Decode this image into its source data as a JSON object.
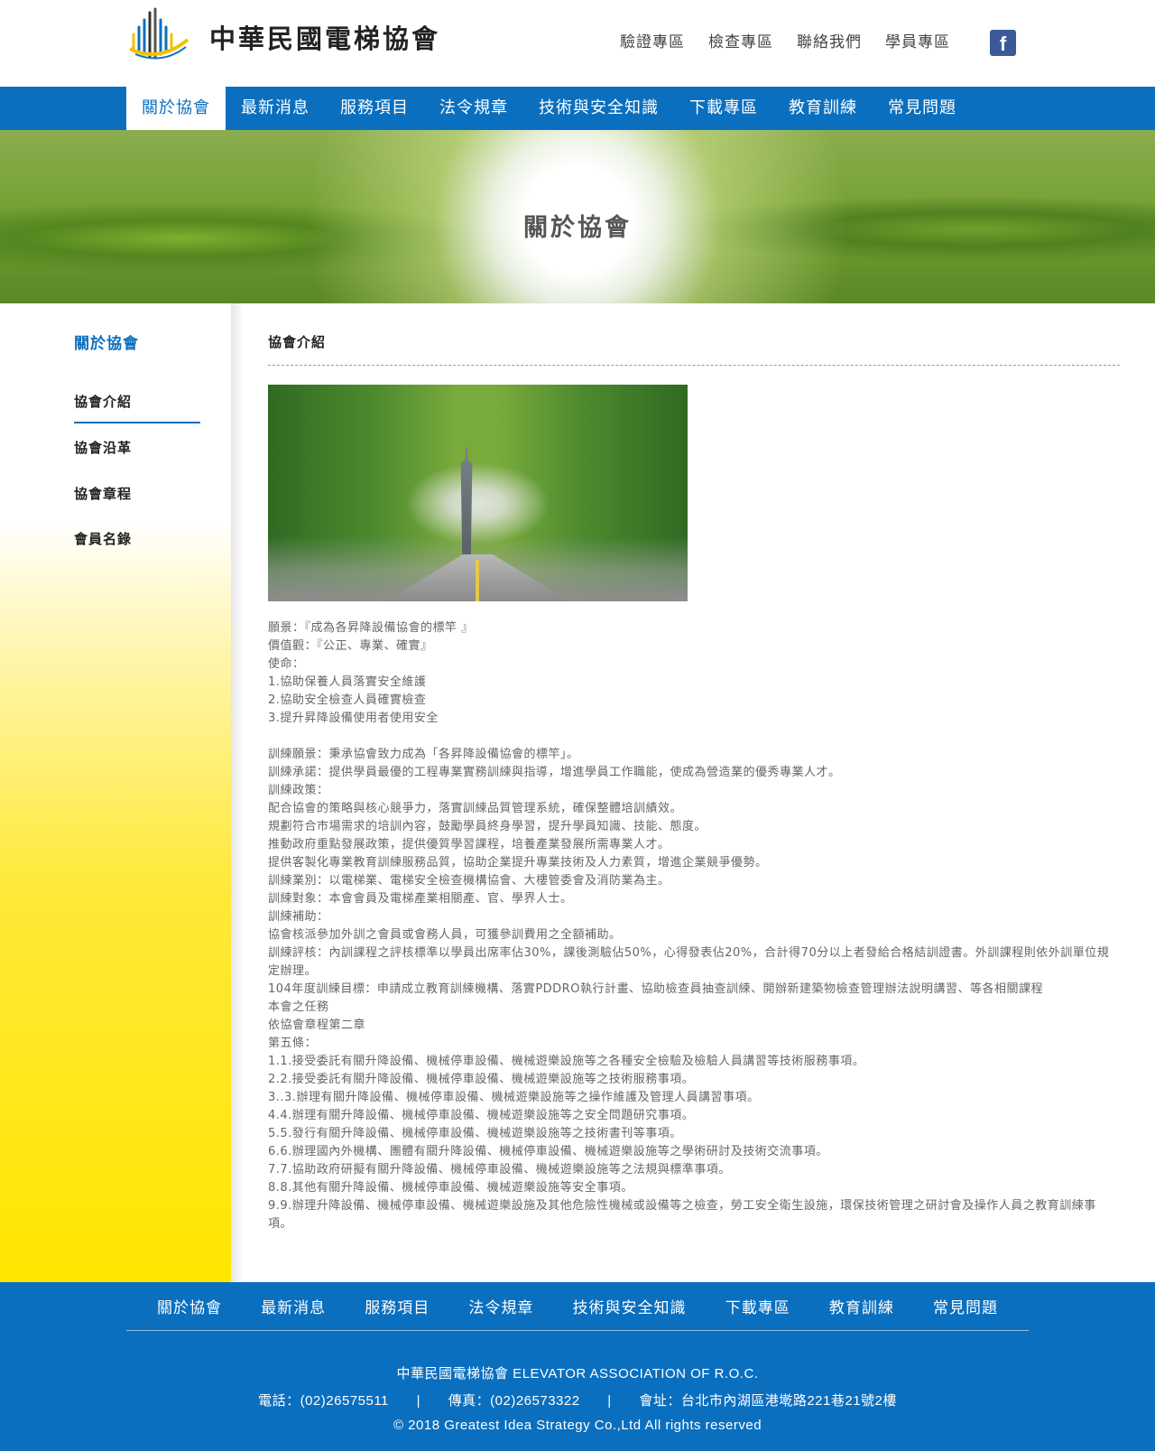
{
  "header": {
    "logo_text": "中華民國電梯協會",
    "top_links": [
      "驗證專區",
      "檢查專區",
      "聯絡我們",
      "學員專區"
    ],
    "facebook_glyph": "f",
    "icons": {
      "facebook": "facebook-icon",
      "logo": "elevator-association-logo"
    }
  },
  "nav": {
    "items": [
      "關於協會",
      "最新消息",
      "服務項目",
      "法令規章",
      "技術與安全知識",
      "下載專區",
      "教育訓練",
      "常見問題"
    ],
    "active": "關於協會"
  },
  "banner": {
    "title": "關於協會"
  },
  "sidebar": {
    "title": "關於協會",
    "items": [
      "協會介紹",
      "協會沿革",
      "協會章程",
      "會員名錄"
    ],
    "active": "協會介紹"
  },
  "content": {
    "title": "協會介紹",
    "lines": [
      "願景：『成為各昇降設備協會的標竿 』",
      "價值觀：『公正、專業、確實』",
      "使命：",
      "1.協助保養人員落實安全維護",
      "2.協助安全檢查人員確實檢查",
      "3.提升昇降設備使用者使用安全",
      "",
      "訓練願景：秉承協會致力成為「各昇降設備協會的標竿」。",
      "訓練承諾：提供學員最優的工程專業實務訓練與指導，增進學員工作職能，使成為營造業的優秀專業人才。",
      "訓練政策：",
      "配合協會的策略與核心競爭力，落實訓練品質管理系統，確保整體培訓績效。",
      "規劃符合市場需求的培訓內容，鼓勵學員終身學習，提升學員知識、技能、態度。",
      "推動政府重點發展政策，提供優質學習課程，培養產業發展所需專業人才。",
      "提供客製化專業教育訓練服務品質，協助企業提升專業技術及人力素質，增進企業競爭優勢。",
      "訓練業別：以電梯業、電梯安全檢查機構協會、大樓管委會及消防業為主。",
      "訓練對象：本會會員及電梯產業相關產、官、學界人士。",
      "訓練補助：",
      "協會核派參加外訓之會員或會務人員，可獲參訓費用之全額補助。",
      "訓練評核：內訓課程之評核標準以學員出席率佔30%，課後測驗佔50%，心得發表佔20%，合計得70分以上者發給合格結訓證書。外訓課程則依外訓單位規定辦理。",
      "104年度訓練目標：申請成立教育訓練機構、落實PDDRO執行計畫、協助檢查員抽查訓練、開辦新建築物檢查管理辦法說明講習、等各相關課程",
      "本會之任務",
      "依協會章程第二章",
      "第五條：",
      "1.1.接受委託有關升降設備、機械停車設備、機械遊樂設施等之各種安全檢驗及檢驗人員講習等技術服務事項。",
      "2.2.接受委託有關升降設備、機械停車設備、機械遊樂設施等之技術服務事項。",
      "3..3.辦理有關升降設備、機械停車設備、機械遊樂設施等之操作維護及管理人員講習事項。",
      "4.4.辦理有關升降設備、機械停車設備、機械遊樂設施等之安全問題研究事項。",
      "5.5.發行有關升降設備、機械停車設備、機械遊樂設施等之技術書刊等事項。",
      "6.6.辦理國內外機構、團體有關升降設備、機械停車設備、機械遊樂設施等之學術研討及技術交流事項。",
      "7.7.協助政府研擬有關升降設備、機械停車設備、機械遊樂設施等之法規與標準事項。",
      "8.8.其他有關升降設備、機械停車設備、機械遊樂設施等安全事項。",
      "9.9.辦理升降設備、機械停車設備、機械遊樂設施及其他危險性機械或設備等之檢查，勞工安全衛生設施，環保技術管理之研討會及操作人員之教育訓練事項。"
    ]
  },
  "footer": {
    "nav": [
      "關於協會",
      "最新消息",
      "服務項目",
      "法令規章",
      "技術與安全知識",
      "下載專區",
      "教育訓練",
      "常見問題"
    ],
    "org": "中華民國電梯協會 ELEVATOR ASSOCIATION OF R.O.C.",
    "phone": "電話：(02)26575511",
    "fax": "傳真：(02)26573322",
    "address": "會址：台北市內湖區港墘路221巷21號2樓",
    "separator": "|",
    "copyright": "© 2018 Greatest Idea Strategy Co.,Ltd All rights reserved"
  },
  "colors": {
    "brand_blue": "#0b6fbf",
    "sidebar_yellow": "#ffe600",
    "facebook": "#3b5998"
  }
}
